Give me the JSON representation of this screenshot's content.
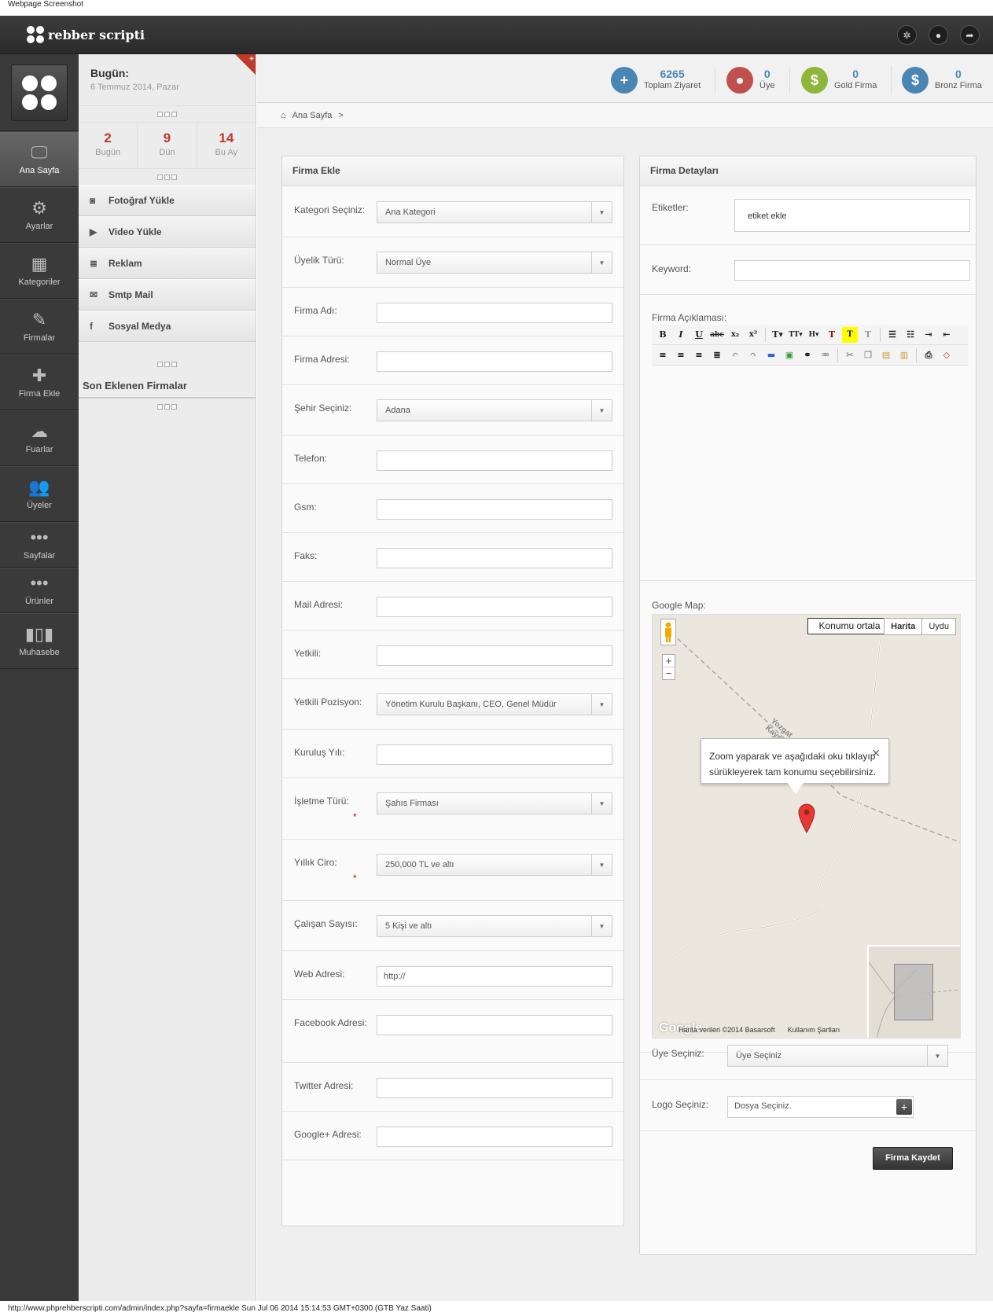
{
  "caption": "Webpage Screenshot",
  "footer": "http://www.phprehberscripti.com/admin/index.php?sayfa=firmaekle Sun Jul 06 2014 15:14:53 GMT+0300 (GTB Yaz Saati)",
  "app": {
    "logo_text": "rebber scripti"
  },
  "header_icons": [
    "gear-icon",
    "user-icon",
    "share-icon"
  ],
  "sidebar": {
    "items": [
      {
        "label": "Ana Sayfa",
        "icon": "monitor-icon",
        "active": true
      },
      {
        "label": "Ayarlar",
        "icon": "gear-icon"
      },
      {
        "label": "Kategoriler",
        "icon": "grid-icon"
      },
      {
        "label": "Firmalar",
        "icon": "edit-icon"
      },
      {
        "label": "Firma Ekle",
        "icon": "plus-icon"
      },
      {
        "label": "Fuarlar",
        "icon": "tree-icon"
      },
      {
        "label": "Üyeler",
        "icon": "users-icon"
      },
      {
        "label": "Sayfalar",
        "icon": "dots-icon"
      },
      {
        "label": "Ürünler",
        "icon": "dots-icon"
      },
      {
        "label": "Muhasebe",
        "icon": "bar-chart-icon"
      }
    ]
  },
  "panel": {
    "today_title": "Bugün:",
    "today_date": "6 Temmuz 2014, Pazar",
    "stats": [
      {
        "value": "2",
        "label": "Bugün"
      },
      {
        "value": "9",
        "label": "Dün"
      },
      {
        "value": "14",
        "label": "Bu Ay"
      }
    ],
    "menu": [
      {
        "label": "Fotoğraf Yükle",
        "icon": "camera-icon"
      },
      {
        "label": "Video Yükle",
        "icon": "video-icon"
      },
      {
        "label": "Reklam",
        "icon": "newspaper-icon"
      },
      {
        "label": "Smtp Mail",
        "icon": "envelope-icon"
      },
      {
        "label": "Sosyal Medya",
        "icon": "facebook-icon"
      }
    ],
    "recent_title": "Son Eklenen Firmalar"
  },
  "topstats": [
    {
      "value": "6265",
      "label": "Toplam Ziyaret",
      "color": "#4a86b4",
      "icon": "+"
    },
    {
      "value": "0",
      "label": "Üye",
      "color": "#c0504d",
      "icon": "👤"
    },
    {
      "value": "0",
      "label": "Gold Firma",
      "color": "#8db63a",
      "icon": "$"
    },
    {
      "value": "0",
      "label": "Bronz Firma",
      "color": "#4a86b4",
      "icon": "$"
    }
  ],
  "breadcrumb": {
    "home": "Ana Sayfa",
    "sep": ">"
  },
  "form_left": {
    "title": "Firma Ekle",
    "fields": [
      {
        "label": "Kategori Seçiniz:",
        "type": "select",
        "value": "Ana Kategori"
      },
      {
        "label": "Üyelik Türü:",
        "type": "select",
        "value": "Normal Üye"
      },
      {
        "label": "Firma Adı:",
        "type": "input",
        "value": ""
      },
      {
        "label": "Firma Adresi:",
        "type": "input",
        "value": ""
      },
      {
        "label": "Şehir Seçiniz:",
        "type": "select",
        "value": "Adana"
      },
      {
        "label": "Telefon:",
        "type": "input",
        "value": ""
      },
      {
        "label": "Gsm:",
        "type": "input",
        "value": ""
      },
      {
        "label": "Faks:",
        "type": "input",
        "value": ""
      },
      {
        "label": "Mail Adresi:",
        "type": "input",
        "value": ""
      },
      {
        "label": "Yetkili:",
        "type": "input",
        "value": ""
      },
      {
        "label": "Yetkili Pozisyon:",
        "type": "select",
        "value": "Yönetim Kurulu Başkanı, CEO, Genel Müdür"
      },
      {
        "label": "Kuruluş Yılı:",
        "type": "input",
        "value": ""
      },
      {
        "label": "İşletme Türü:",
        "type": "select",
        "value": "Şahıs Firması",
        "required": "*"
      },
      {
        "label": "Yıllık Ciro:",
        "type": "select",
        "value": "250,000 TL ve altı",
        "required": "*"
      },
      {
        "label": "Çalışan Sayısı:",
        "type": "select",
        "value": "5 Kişi ve altı"
      },
      {
        "label": "Web Adresi:",
        "type": "input",
        "value": "http://"
      },
      {
        "label": "Facebook Adresi:",
        "type": "input",
        "value": ""
      },
      {
        "label": "Twitter Adresi:",
        "type": "input",
        "value": ""
      },
      {
        "label": "Google+ Adresi:",
        "type": "input",
        "value": ""
      }
    ]
  },
  "form_right": {
    "title": "Firma Detayları",
    "tags_label": "Etiketler:",
    "tags_placeholder": "etiket ekle",
    "keyword_label": "Keyword:",
    "desc_label": "Firma Açıklaması:",
    "map_label": "Google Map:",
    "map": {
      "center_btn": "Konumu ortala",
      "type_map": "Harita",
      "type_sat": "Uydu",
      "info": "Zoom yaparak ve aşağıdaki oku tıklayıp sürükleyerek tam konumu seçebilirsiniz.",
      "road_label": "Yozgat Kayseri",
      "attribution": "Harita verileri ©2014 Basarsoft",
      "terms": "Kullanım Şartları",
      "google": "Google"
    },
    "member_label": "Üye Seçiniz:",
    "member_value": "Üye Seçiniz",
    "logo_label": "Logo Seçiniz:",
    "logo_value": "Dosya Seçiniz.",
    "save_label": "Firma Kaydet"
  }
}
